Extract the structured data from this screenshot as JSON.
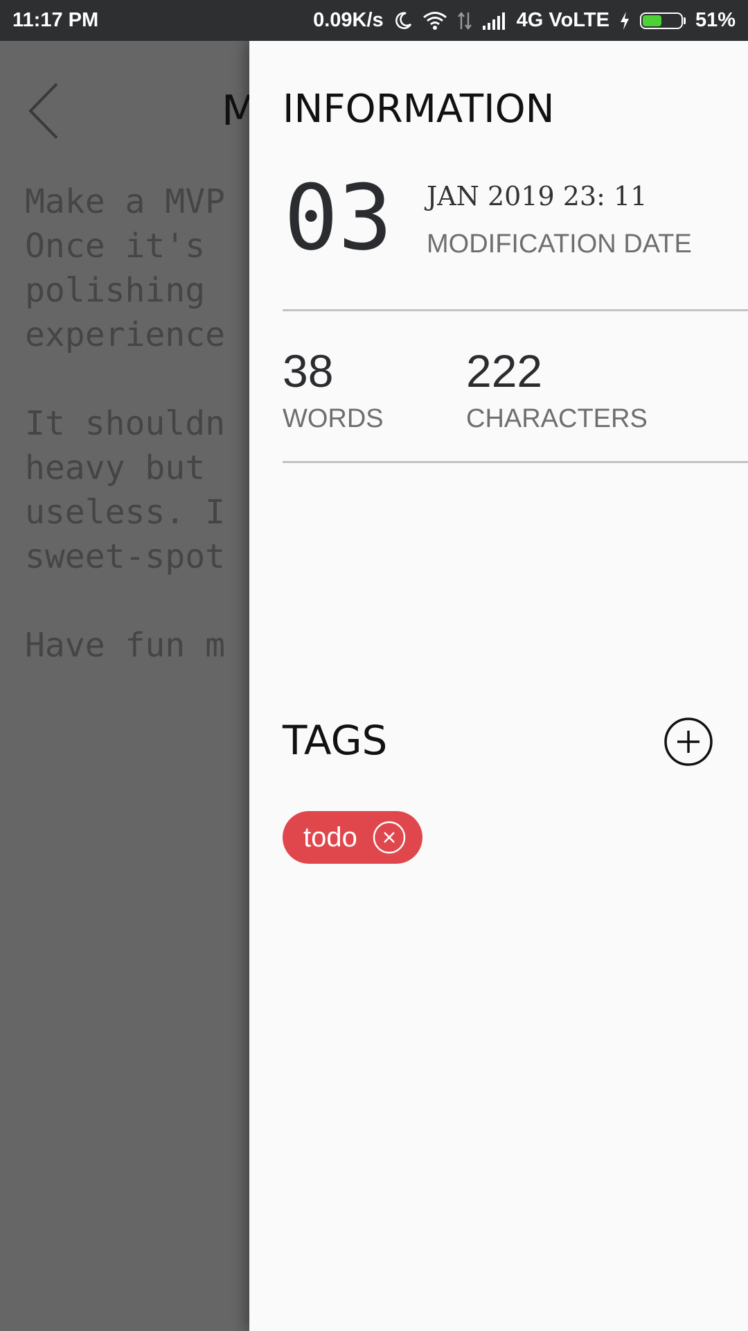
{
  "status_bar": {
    "time": "11:17 PM",
    "network_speed": "0.09K/s",
    "network_type": "4G VoLTE",
    "battery_percent": "51%",
    "battery_level": 0.51,
    "battery_color": "#4cd137"
  },
  "editor": {
    "title_partial": "M",
    "body_partial": "Make a MVP\nOnce it's \npolishing \nexperience\n\nIt shouldn\nheavy but \nuseless. I\nsweet-spot\n\nHave fun m"
  },
  "info_panel": {
    "title": "INFORMATION",
    "modification": {
      "day": "03",
      "date": "JAN 2019 23: 11",
      "label": "MODIFICATION DATE"
    },
    "stats": {
      "words_value": "38",
      "words_label": "WORDS",
      "characters_value": "222",
      "characters_label": "CHARACTERS"
    },
    "tags": {
      "title": "TAGS",
      "add_icon": "plus-circle-icon",
      "items": [
        {
          "label": "todo",
          "color": "#e0474c",
          "remove_icon": "close-circle-icon"
        }
      ]
    }
  },
  "colors": {
    "status_bar_bg": "#2d2f31",
    "overlay_bg": "#666666",
    "panel_bg": "#fafafa",
    "tag_bg": "#e0474c"
  }
}
